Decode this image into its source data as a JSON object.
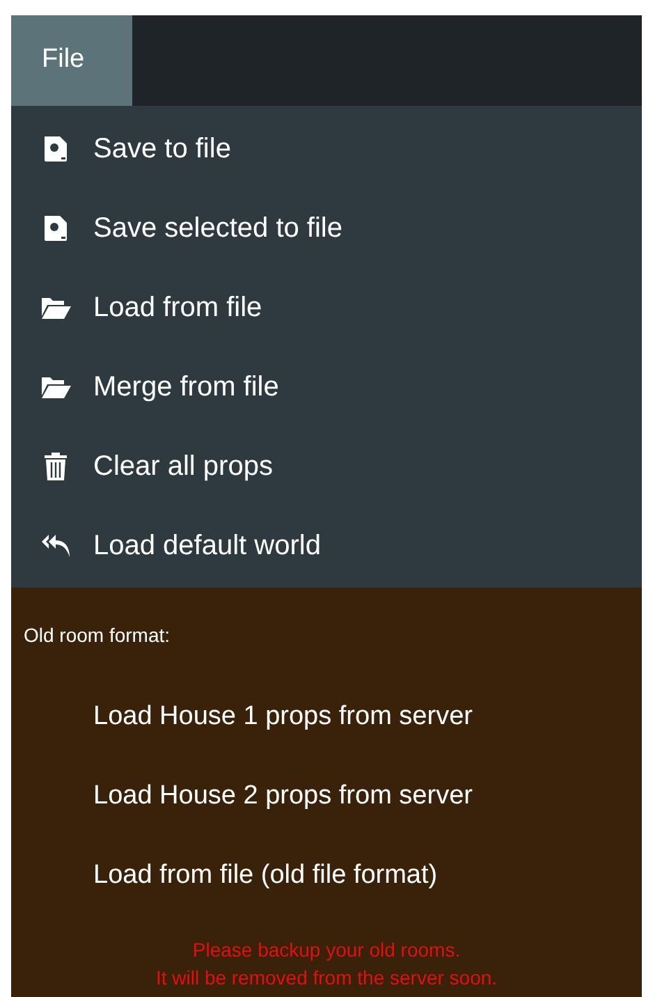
{
  "menu_bar": {
    "menus": [
      {
        "label": "File",
        "selected": true
      }
    ]
  },
  "file_menu": {
    "items": [
      {
        "label": "Save to file"
      },
      {
        "label": "Save selected to file"
      },
      {
        "label": "Load from file"
      },
      {
        "label": "Merge from file"
      },
      {
        "label": "Clear all props"
      },
      {
        "label": "Load default world"
      }
    ]
  },
  "old_format": {
    "heading": "Old room format:",
    "items": [
      "Load House 1 props from server",
      "Load House 2 props from server",
      "Load from file (old file format)"
    ],
    "warning": [
      "Please backup your old rooms.",
      "It will be removed from the server soon."
    ]
  }
}
